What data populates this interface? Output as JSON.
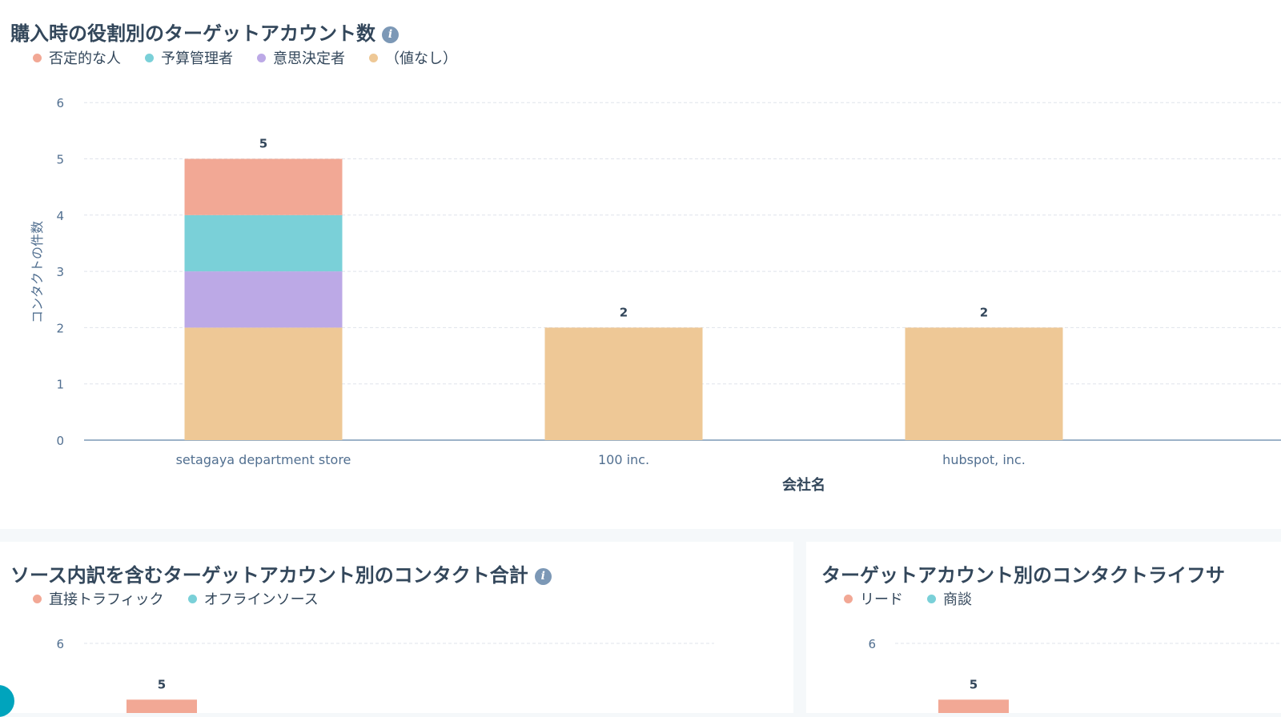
{
  "chart1": {
    "title": "購入時の役割別のターゲットアカウント数",
    "legend": [
      {
        "label": "否定的な人",
        "color": "#f2a895"
      },
      {
        "label": "予算管理者",
        "color": "#7ad0d8"
      },
      {
        "label": "意思決定者",
        "color": "#bca9e6"
      },
      {
        "label": "（値なし）",
        "color": "#eec896"
      }
    ]
  },
  "chart2": {
    "title": "ソース内訳を含むターゲットアカウント別のコンタクト合計",
    "legend": [
      {
        "label": "直接トラフィック",
        "color": "#f2a895"
      },
      {
        "label": "オフラインソース",
        "color": "#7ad0d8"
      }
    ]
  },
  "chart3": {
    "title": "ターゲットアカウント別のコンタクトライフサ",
    "legend": [
      {
        "label": "リード",
        "color": "#f2a895"
      },
      {
        "label": "商談",
        "color": "#7ad0d8"
      }
    ]
  },
  "chart_data": [
    {
      "type": "bar",
      "stacked": true,
      "title": "購入時の役割別のターゲットアカウント数",
      "xlabel": "会社名",
      "ylabel": "コンタクトの件数",
      "categories": [
        "setagaya department store",
        "100 inc.",
        "hubspot, inc."
      ],
      "series": [
        {
          "name": "（値なし）",
          "values": [
            2,
            2,
            2
          ],
          "color": "#eec896"
        },
        {
          "name": "意思決定者",
          "values": [
            1,
            0,
            0
          ],
          "color": "#bca9e6"
        },
        {
          "name": "予算管理者",
          "values": [
            1,
            0,
            0
          ],
          "color": "#7ad0d8"
        },
        {
          "name": "否定的な人",
          "values": [
            1,
            0,
            0
          ],
          "color": "#f2a895"
        }
      ],
      "totals": [
        5,
        2,
        2
      ],
      "ylim": [
        0,
        6
      ],
      "yticks": [
        0,
        1,
        2,
        3,
        4,
        5,
        6
      ],
      "grid": true,
      "legend_position": "top-left"
    },
    {
      "type": "bar",
      "stacked": true,
      "title": "ソース内訳を含むターゲットアカウント別のコンタクト合計",
      "series": [
        {
          "name": "直接トラフィック",
          "values": [],
          "color": "#f2a895"
        },
        {
          "name": "オフラインソース",
          "values": [],
          "color": "#7ad0d8"
        }
      ],
      "totals": [
        5
      ],
      "yticks_visible": [
        6
      ],
      "grid": true,
      "legend_position": "top-left"
    },
    {
      "type": "bar",
      "stacked": true,
      "title": "ターゲットアカウント別のコンタクトライフサ",
      "series": [
        {
          "name": "リード",
          "values": [],
          "color": "#f2a895"
        },
        {
          "name": "商談",
          "values": [],
          "color": "#7ad0d8"
        }
      ],
      "totals": [
        5
      ],
      "yticks_visible": [
        6
      ],
      "grid": true,
      "legend_position": "top-left"
    }
  ]
}
